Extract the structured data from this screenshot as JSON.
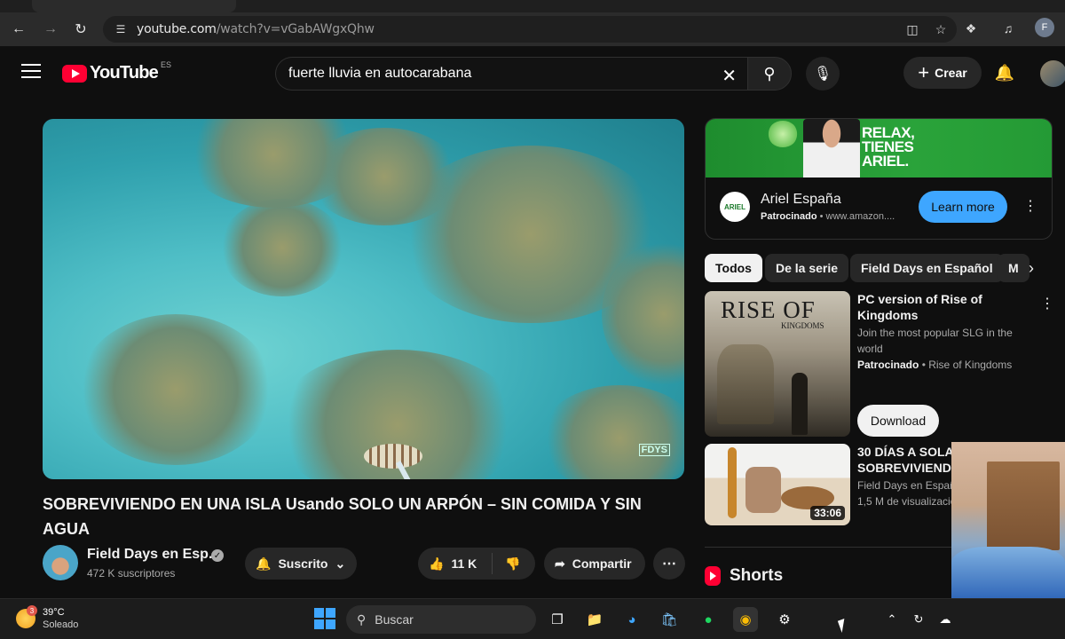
{
  "browser": {
    "url_domain": "youtube.com",
    "url_path": "/watch?v=vGabAWgxQhw",
    "profile_initial": "F"
  },
  "header": {
    "logo_text": "YouTube",
    "country_code": "ES",
    "search_query": "fuerte lluvia en autocarabana",
    "create_label": "Crear"
  },
  "player": {
    "watermark": "FDYS"
  },
  "video": {
    "title": "SOBREVIVIENDO EN UNA ISLA Usando SOLO UN ARPÓN – SIN COMIDA Y SIN AGUA",
    "channel_name": "Field Days en Esp...",
    "subscribers": "472 K suscriptores",
    "subscribed_label": "Suscrito",
    "likes": "11 K",
    "share_label": "Compartir"
  },
  "ad": {
    "slogan_line1": "Relax,",
    "slogan_line2": "tienes",
    "slogan_line3": "Ariel.",
    "logo_text": "ARIEL",
    "advertiser": "Ariel España",
    "sponsored_label": "Patrocinado",
    "sponsored_url": " • www.amazon....",
    "cta": "Learn more"
  },
  "chips": [
    "Todos",
    "De la serie",
    "Field Days en Español",
    "M"
  ],
  "recommendations": [
    {
      "thumb_title": "RISE OF",
      "thumb_subtitle": "KINGDOMS",
      "title": "PC version of Rise of Kingdoms",
      "description": "Join the most popular SLG in the world",
      "sponsored_label": "Patrocinado",
      "sponsor": " • Rise of Kingdoms",
      "cta": "Download"
    },
    {
      "title_line1": "30 DÍAS A SOLAS:",
      "title_line2": "SOBREVIVIENDO",
      "channel": "Field Days en Español",
      "views": "1,5 M de visualizaciones",
      "duration": "33:06"
    }
  ],
  "shorts_label": "Shorts",
  "taskbar": {
    "weather_badge": "3",
    "temperature": "39°C",
    "condition": "Soleado",
    "search_placeholder": "Buscar"
  }
}
